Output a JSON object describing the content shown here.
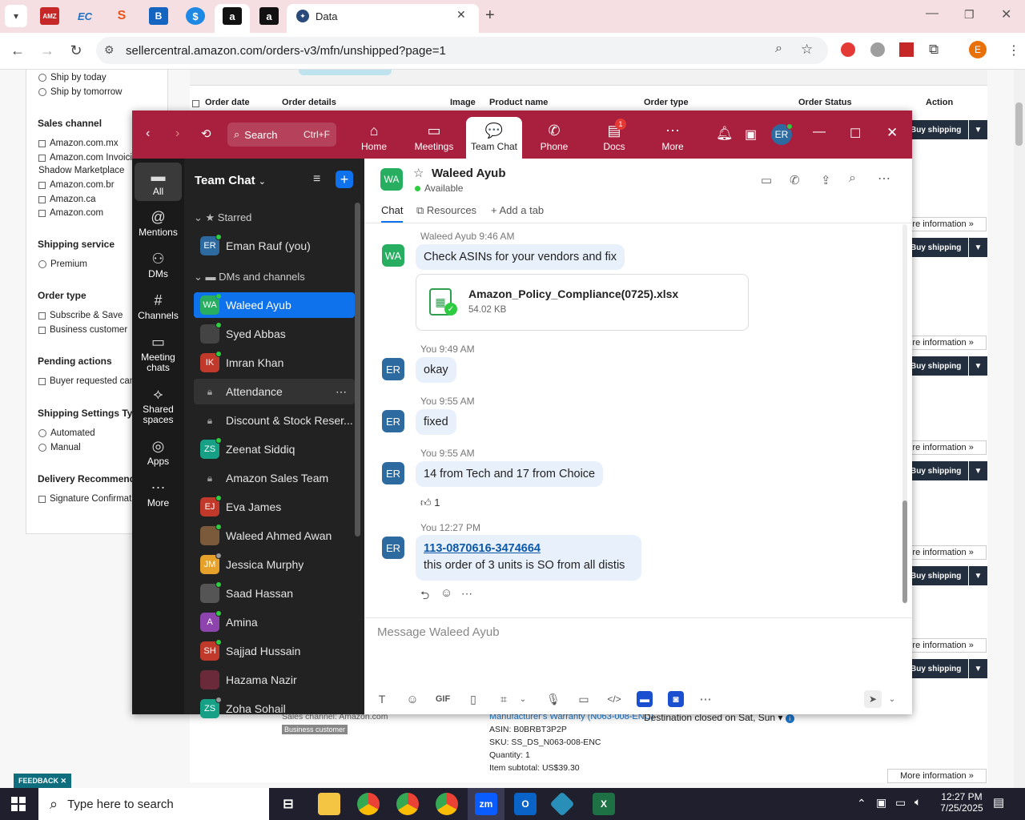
{
  "browser": {
    "active_tab_title": "Data",
    "url": "sellercentral.amazon.com/orders-v3/mfn/unshipped?page=1",
    "tabs": [
      "AMZ",
      "EC",
      "S",
      "B",
      "$",
      "a",
      "a"
    ],
    "profile_letter": "E"
  },
  "amazon": {
    "filters": {
      "ship_today": "Ship by today",
      "ship_tomorrow": "Ship by tomorrow",
      "sales_channel_title": "Sales channel",
      "channels": [
        "Amazon.com.mx",
        "Amazon.com Invoicing Shadow Marketplace",
        "Amazon.com.br",
        "Amazon.ca",
        "Amazon.com"
      ],
      "channel_display": [
        "Amazon.com.mx",
        "Amazon.com Invoici",
        "Shadow Marketplace",
        "Amazon.com.br",
        "Amazon.ca",
        "Amazon.com"
      ],
      "shipping_service_title": "Shipping service",
      "shipping_service": "Premium",
      "order_type_title": "Order type",
      "order_types": [
        "Subscribe & Save",
        "Business customer"
      ],
      "pending_title": "Pending actions",
      "pending": "Buyer requested can",
      "settings_title": "Shipping Settings Type",
      "settings": [
        "Automated",
        "Manual"
      ],
      "delivery_title": "Delivery Recommenda",
      "delivery": "Signature Confirmat"
    },
    "columns": [
      "Order date",
      "Order details",
      "Image",
      "Product name",
      "Order type",
      "Order Status",
      "Action"
    ],
    "more_info": "More information",
    "buy_shipping": "Buy shipping",
    "order_bottom": {
      "sales_channel": "Sales channel: Amazon.com",
      "badge": "Business customer",
      "product": "Manufacturer's Warranty (N063-008-ENC)",
      "destination": "Destination closed on Sat, Sun",
      "asin": "ASIN: B0BRBT3P2P",
      "sku": "SKU: SS_DS_N063-008-ENC",
      "quantity": "Quantity: 1",
      "subtotal": "Item subtotal: US$39.30"
    },
    "feedback": "FEEDBACK"
  },
  "zoom": {
    "search_label": "Search",
    "search_shortcut": "Ctrl+F",
    "nav": [
      "Home",
      "Meetings",
      "Team Chat",
      "Phone",
      "Docs",
      "More"
    ],
    "docs_badge": "1",
    "profile_initials": "ER",
    "rail": [
      "All",
      "Mentions",
      "DMs",
      "Channels",
      "Meeting chats",
      "Shared spaces",
      "Apps",
      "More"
    ],
    "list_title": "Team Chat",
    "starred_label": "Starred",
    "dms_label": "DMs and channels",
    "starred": [
      {
        "initials": "ER",
        "name": "Eman Rauf (you)",
        "color": "#2d6a9f"
      }
    ],
    "contacts": [
      {
        "initials": "WA",
        "name": "Waleed Ayub",
        "color": "#27ae60",
        "type": "person",
        "status": "green"
      },
      {
        "initials": "",
        "name": "Syed Abbas",
        "color": "#444",
        "type": "person",
        "status": "green"
      },
      {
        "initials": "IK",
        "name": "Imran Khan",
        "color": "#c0392b",
        "type": "person",
        "status": "green"
      },
      {
        "initials": "",
        "name": "Attendance",
        "color": "",
        "type": "channel",
        "status": ""
      },
      {
        "initials": "",
        "name": "Discount & Stock Reser...",
        "color": "",
        "type": "channel",
        "status": ""
      },
      {
        "initials": "ZS",
        "name": "Zeenat Siddiq",
        "color": "#16a085",
        "type": "person",
        "status": "green"
      },
      {
        "initials": "",
        "name": "Amazon Sales Team",
        "color": "",
        "type": "channel",
        "status": ""
      },
      {
        "initials": "EJ",
        "name": "Eva James",
        "color": "#c0392b",
        "type": "person",
        "status": "green"
      },
      {
        "initials": "",
        "name": "Waleed Ahmed Awan",
        "color": "#7a5a3a",
        "type": "person",
        "status": "green"
      },
      {
        "initials": "JM",
        "name": "Jessica Murphy",
        "color": "#e6a12b",
        "type": "person",
        "status": "grey"
      },
      {
        "initials": "",
        "name": "Saad Hassan",
        "color": "#555",
        "type": "person",
        "status": "green"
      },
      {
        "initials": "A",
        "name": "Amina",
        "color": "#8e44ad",
        "type": "person",
        "status": "green"
      },
      {
        "initials": "SH",
        "name": "Sajjad Hussain",
        "color": "#c0392b",
        "type": "person",
        "status": "green"
      },
      {
        "initials": "",
        "name": "Hazama Nazir",
        "color": "#6b2a3a",
        "type": "person",
        "status": ""
      },
      {
        "initials": "ZS",
        "name": "Zoha Sohail",
        "color": "#16a085",
        "type": "person",
        "status": "grey"
      }
    ],
    "chat": {
      "name": "Waleed Ayub",
      "initials": "WA",
      "status": "Available",
      "tabs": [
        "Chat",
        "Resources",
        "Add a tab"
      ],
      "messages": [
        {
          "sender": "Waleed Ayub",
          "time": "9:46 AM",
          "text": "Check ASINs for your vendors and fix"
        },
        {
          "sender": "You",
          "time": "9:49 AM",
          "text": "okay"
        },
        {
          "sender": "You",
          "time": "9:55 AM",
          "text": "fixed"
        },
        {
          "sender": "You",
          "time": "9:55 AM",
          "text": "14 from Tech and 17 from Choice",
          "reaction": "1"
        },
        {
          "sender": "You",
          "time": "12:27 PM",
          "link": "113-0870616-3474664",
          "text": "this order of 3 units is SO from all distis"
        }
      ],
      "file": {
        "name": "Amazon_Policy_Compliance(0725).xlsx",
        "size": "54.02 KB"
      },
      "my_initials": "ER",
      "composer_placeholder": "Message Waleed Ayub",
      "gif_label": "GIF"
    }
  },
  "taskbar": {
    "search_placeholder": "Type here to search",
    "time": "12:27 PM",
    "date": "7/25/2025"
  }
}
